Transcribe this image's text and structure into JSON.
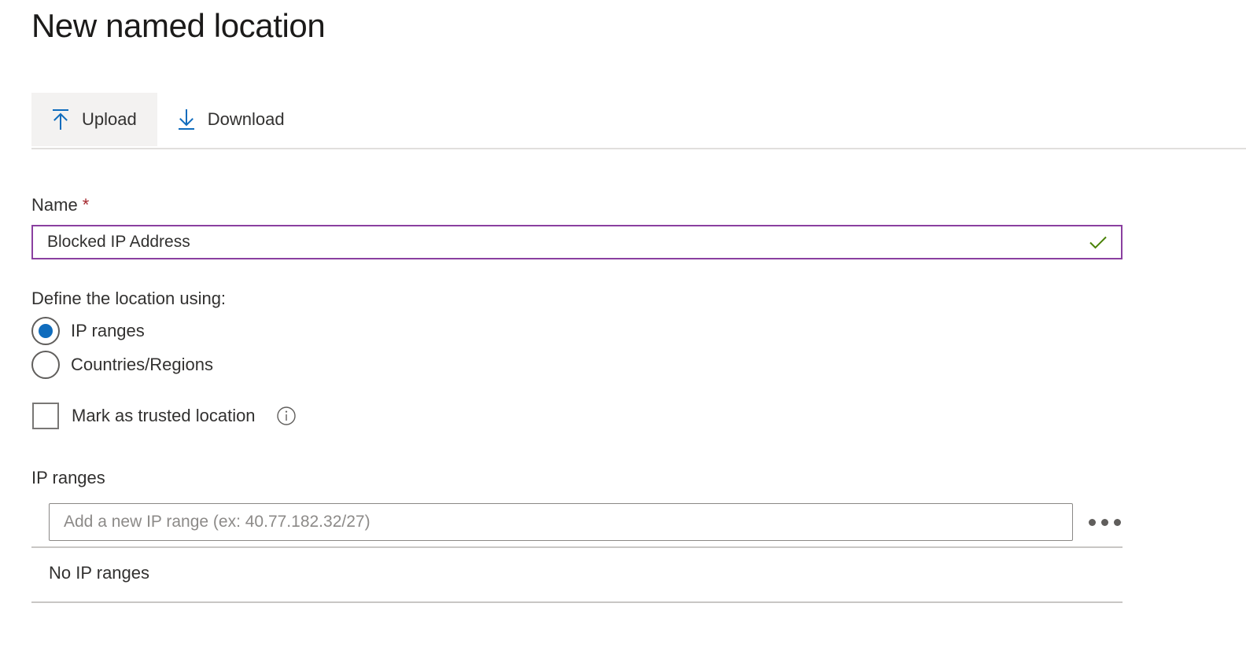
{
  "page": {
    "title": "New named location"
  },
  "toolbar": {
    "upload": {
      "label": "Upload",
      "icon": "upload-icon"
    },
    "download": {
      "label": "Download",
      "icon": "download-icon"
    }
  },
  "form": {
    "name": {
      "label": "Name",
      "required_marker": "*",
      "value": "Blocked IP Address",
      "placeholder": "",
      "validation_icon": "checkmark-icon",
      "valid_color": "#498205",
      "focus_border_color": "#8a3fa0"
    },
    "define_using": {
      "label": "Define the location using:",
      "options": [
        {
          "label": "IP ranges",
          "selected": true
        },
        {
          "label": "Countries/Regions",
          "selected": false
        }
      ],
      "selected_color": "#0f6cbd"
    },
    "trusted": {
      "label": "Mark as trusted location",
      "checked": false,
      "info_icon": "info-icon"
    },
    "ip_ranges": {
      "label": "IP ranges",
      "add_placeholder": "Add a new IP range (ex: 40.77.182.32/27)",
      "add_value": "",
      "more_actions_icon": "ellipsis-icon",
      "empty_text": "No IP ranges"
    }
  },
  "colors": {
    "accent": "#0f6cbd",
    "purple_focus": "#8a3fa0",
    "green_valid": "#498205",
    "required_red": "#a4262c",
    "divider": "#c8c6c4",
    "toolbar_active_bg": "#f3f2f1"
  }
}
